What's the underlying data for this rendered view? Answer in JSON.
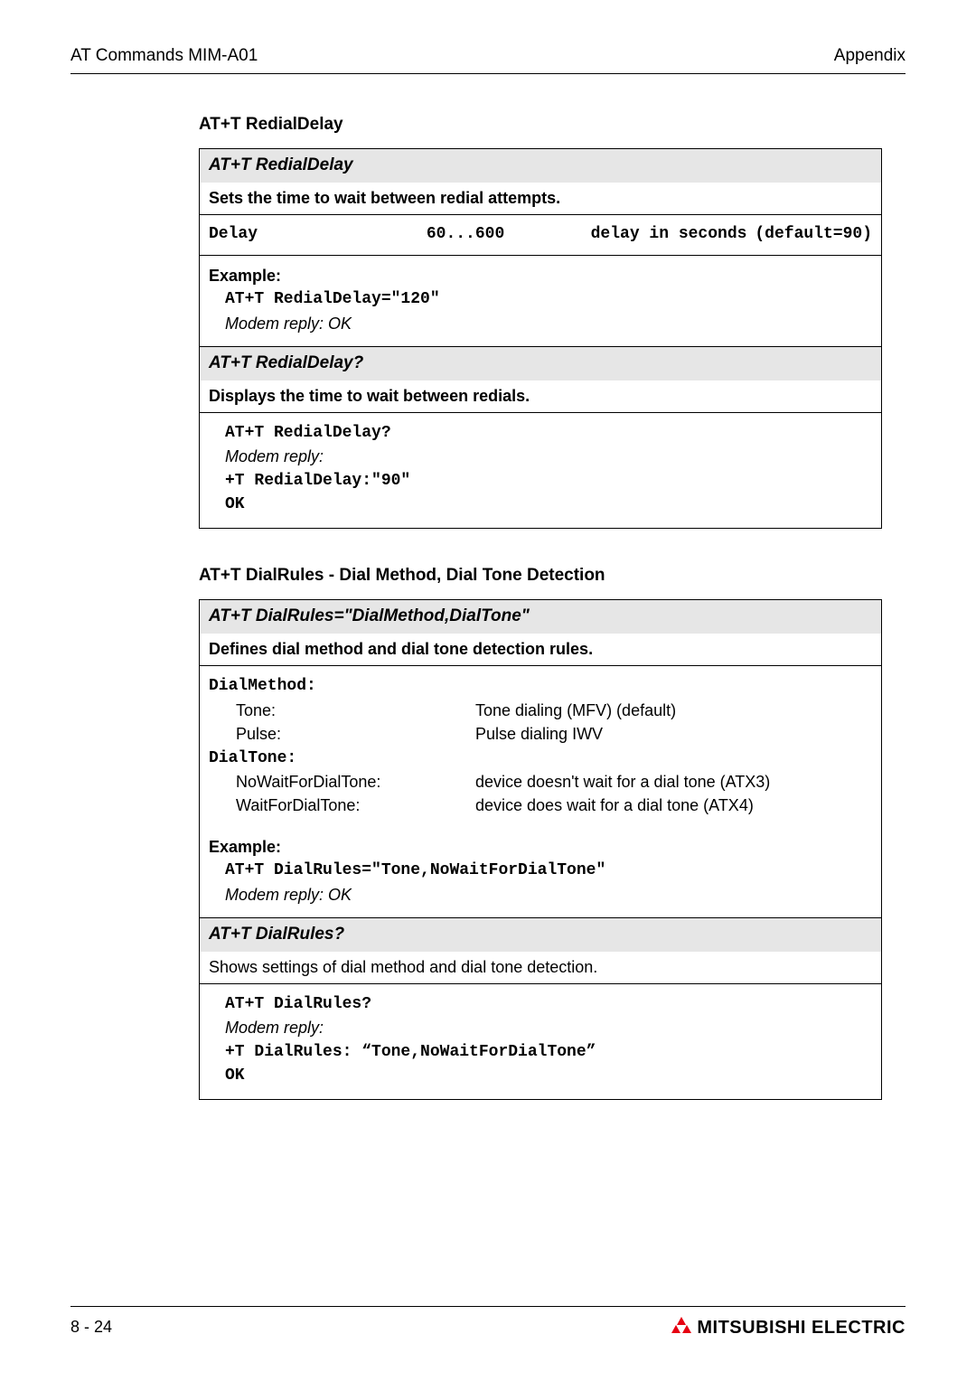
{
  "header": {
    "left": "AT Commands MIM-A01",
    "right": "Appendix"
  },
  "section1": {
    "title": "AT+T RedialDelay",
    "cmd_set": "AT+T RedialDelay",
    "desc_set": "Sets the time to wait between redial attempts.",
    "param_name": "Delay",
    "param_range": "60...600",
    "param_meaning": "delay in seconds",
    "param_default": "(default=90)",
    "example_label": "Example:",
    "example_cmd": "AT+T RedialDelay=\"120\"",
    "example_reply": "Modem reply:  OK",
    "cmd_query": "AT+T RedialDelay?",
    "desc_query": "Displays the time to wait between redials.",
    "q_cmd": "AT+T RedialDelay?",
    "q_reply_label": "Modem reply:",
    "q_reply_l1": "+T RedialDelay:\"90\"",
    "q_reply_l2": "OK"
  },
  "section2": {
    "title": "AT+T DialRules - Dial Method, Dial Tone Detection",
    "cmd_set": "AT+T DialRules=\"DialMethod,DialTone\"",
    "desc_set": "Defines dial method and dial tone detection rules.",
    "dm_label": "DialMethod:",
    "dm_tone_k": "Tone:",
    "dm_tone_v": "Tone dialing (MFV) (default)",
    "dm_pulse_k": "Pulse:",
    "dm_pulse_v": "Pulse dialing IWV",
    "dt_label": "DialTone:",
    "dt_nowait_k": "NoWaitForDialTone:",
    "dt_nowait_v": "device doesn't wait for a dial tone (ATX3)",
    "dt_wait_k": "WaitForDialTone:",
    "dt_wait_v": "device does wait for a dial tone (ATX4)",
    "example_label": "Example:",
    "example_cmd": "AT+T DialRules=\"Tone,NoWaitForDialTone\"",
    "example_reply": "Modem reply:  OK",
    "cmd_query": "AT+T DialRules?",
    "desc_query": "Shows settings of dial method and dial tone detection.",
    "q_cmd": "AT+T DialRules?",
    "q_reply_label": "Modem reply:",
    "q_reply_l1": "+T DialRules: “Tone,NoWaitForDialTone”",
    "q_reply_l2": "OK"
  },
  "footer": {
    "page": "8 - 24",
    "brand": "MITSUBISHI ELECTRIC"
  }
}
